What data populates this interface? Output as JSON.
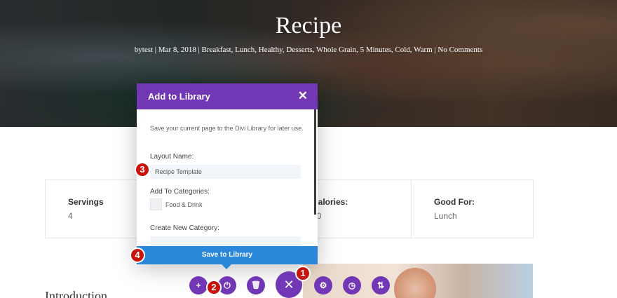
{
  "hero": {
    "title": "Recipe",
    "meta": "bytest | Mar 8, 2018 | Breakfast, Lunch, Healthy, Desserts, Whole Grain, 5 Minutes, Cold, Warm | No Comments"
  },
  "info": [
    {
      "label": "Servings",
      "value": "4"
    },
    {
      "label": "",
      "value": ""
    },
    {
      "label": "Calories:",
      "value": "10"
    },
    {
      "label": "Good For:",
      "value": "Lunch"
    }
  ],
  "intro_heading": "Introduction",
  "modal": {
    "title": "Add to Library",
    "close_symbol": "✕",
    "description": "Save your current page to the Divi Library for later use.",
    "layout_name_label": "Layout Name:",
    "layout_name_value": "Recipe Template",
    "categories_label": "Add To Categories:",
    "category_option": "Food & Drink",
    "new_category_label": "Create New Category:",
    "new_category_value": "",
    "save_button": "Save to Library"
  },
  "toolbar": {
    "add_symbol": "+",
    "power_symbol": "⏻",
    "trash_symbol": "🗑",
    "close_symbol": "✕",
    "settings_symbol": "⚙",
    "history_symbol": "◷",
    "portability_symbol": "⇅"
  },
  "markers": [
    "1",
    "2",
    "3",
    "4"
  ],
  "colors": {
    "accent_purple": "#7137b5",
    "save_blue": "#2b87da",
    "marker_red": "#c9120b"
  }
}
